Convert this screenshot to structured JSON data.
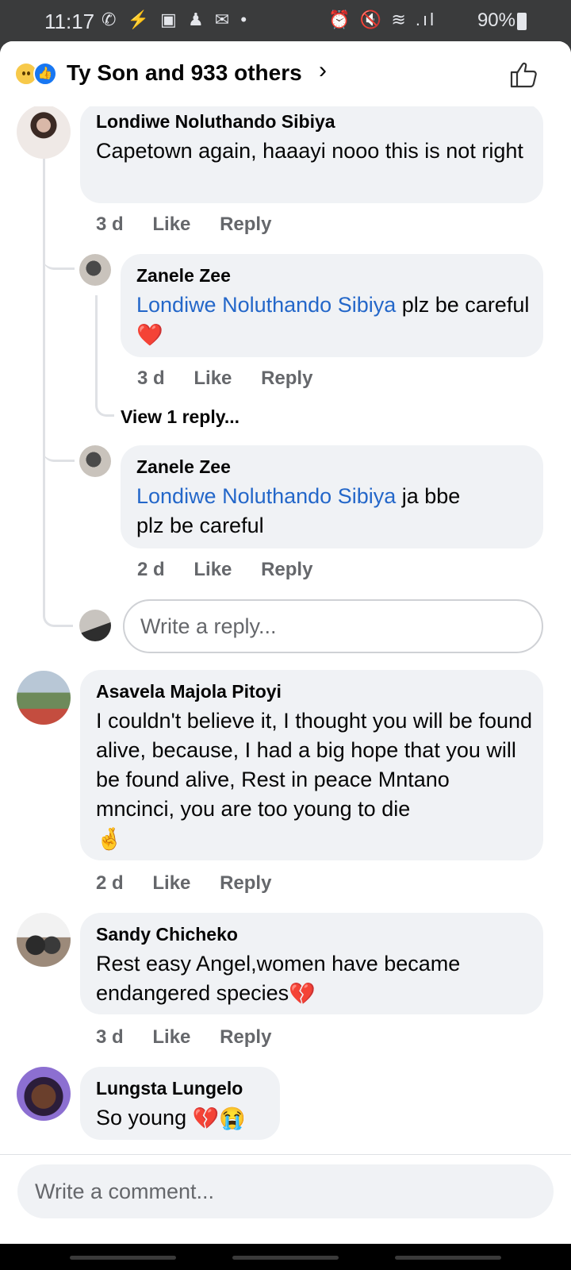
{
  "status_bar": {
    "time": "11:17",
    "left_icons": "✆ ⚡ ▣ ♟ ✉ •",
    "right_icons": "⏰ 🔇 ≋ .ıl",
    "battery": "90%"
  },
  "header": {
    "reactions_title": "Ty Son and 933 others",
    "like_icon": "thumbs-up-outline-icon"
  },
  "comments": [
    {
      "author": "Londiwe Noluthando Sibiya",
      "text": "Capetown again, haaayi nooo this is not right",
      "time": "3 d",
      "like": "Like",
      "reply": "Reply"
    },
    {
      "author": "Zanele Zee",
      "mention": "Londiwe Noluthando Sibiya",
      "text": "plz be careful",
      "emoji": "❤️",
      "time": "3 d",
      "like": "Like",
      "reply": "Reply",
      "view_replies": "View 1 reply..."
    },
    {
      "author": "Zanele Zee",
      "mention": "Londiwe Noluthando Sibiya",
      "text_line1": "ja bbe",
      "text_line2": "plz be careful",
      "time": "2 d",
      "like": "Like",
      "reply": "Reply"
    },
    {
      "author": "Asavela Majola Pitoyi",
      "text": "I couldn't believe it, I thought you will be found alive, because, I had a big hope that you will be found alive, Rest in peace Mntano mncinci, you are too young to die",
      "emoji": "🤞",
      "time": "2 d",
      "like": "Like",
      "reply": "Reply"
    },
    {
      "author": "Sandy Chicheko",
      "text": "Rest easy Angel,women have became endangered species",
      "emoji": "💔",
      "time": "3 d",
      "like": "Like",
      "reply": "Reply"
    },
    {
      "author": "Lungsta Lungelo",
      "text": "So young",
      "emoji": "💔😭"
    }
  ],
  "reply_input": {
    "placeholder": "Write a reply..."
  },
  "comment_input": {
    "placeholder": "Write a comment..."
  }
}
